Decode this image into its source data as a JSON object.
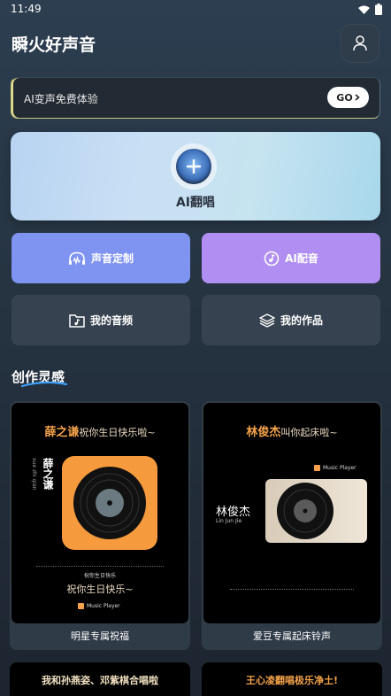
{
  "status_bar": {
    "time": "11:49"
  },
  "header": {
    "title": "瞬火好声音"
  },
  "promo": {
    "text": "AI变声免费体验",
    "go_label": "GO"
  },
  "ai_cover": {
    "label": "AI翻唱"
  },
  "features": {
    "voice_custom": "声音定制",
    "ai_dub": "AI配音",
    "my_audio": "我的音频",
    "my_works": "我的作品"
  },
  "section": {
    "title": "创作灵感"
  },
  "inspirations": [
    {
      "caption": "明星专属祝福",
      "headline_name": "薛之谦",
      "headline_rest": "祝你生日快乐啦~",
      "vertical_name": "薛之谦",
      "vertical_pinyin": "xue zhi qian",
      "sub_line": "祝你生日快乐",
      "bottom_line": "祝你生日快乐~",
      "brand": "Music Player"
    },
    {
      "caption": "爱豆专属起床铃声",
      "headline_name": "林俊杰",
      "headline_rest": "叫你起床啦~",
      "brand": "Music Player",
      "side_name": "林俊杰",
      "side_pinyin": "Lin  Jun  Jie"
    }
  ],
  "peek_cards": [
    {
      "text": "我和孙燕姿、邓紫棋合唱啦"
    },
    {
      "text": "王心凌翻唱极乐净土!"
    }
  ],
  "colors": {
    "voice_custom_bg": "#7f93f1",
    "ai_dub_bg": "#b08ef2",
    "accent_orange": "#f4a24a"
  }
}
